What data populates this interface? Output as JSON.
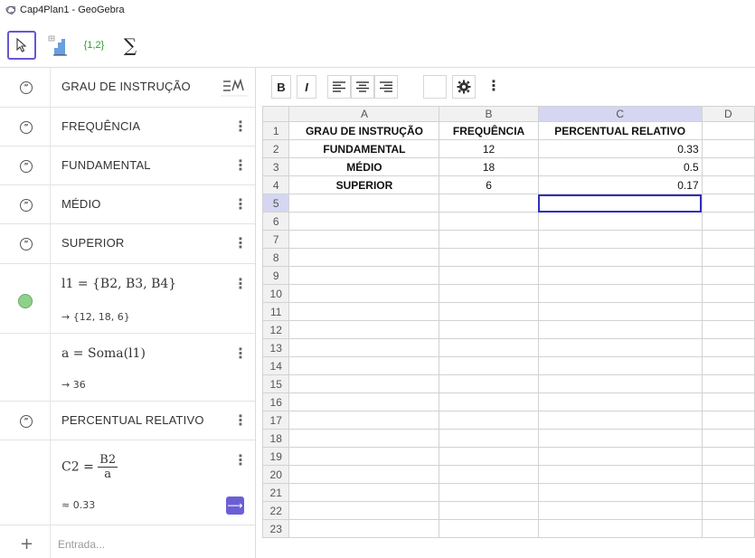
{
  "window": {
    "title": "Cap4Plan1 - GeoGebra"
  },
  "toolbar": {
    "tools": [
      {
        "name": "move-tool",
        "icon": "cursor-arrow-icon"
      },
      {
        "name": "bar-chart-tool",
        "icon": "bar-chart-icon"
      },
      {
        "name": "list-tool",
        "label": "{1,2}"
      },
      {
        "name": "sum-tool",
        "label": "∑"
      }
    ]
  },
  "algebra": {
    "items": [
      {
        "kind": "text",
        "text": "GRAU DE INSTRUÇÃO"
      },
      {
        "kind": "text",
        "text": "FREQUÊNCIA"
      },
      {
        "kind": "text",
        "text": "FUNDAMENTAL"
      },
      {
        "kind": "text",
        "text": "MÉDIO"
      },
      {
        "kind": "text",
        "text": "SUPERIOR"
      },
      {
        "kind": "list",
        "definition": "l1 = {B2, B3, B4}",
        "output": "→ {12, 18, 6}"
      },
      {
        "kind": "number",
        "definition": "a = Soma(l1)",
        "output": "→ 36"
      },
      {
        "kind": "text",
        "text": "PERCENTUAL RELATIVO"
      },
      {
        "kind": "fraction",
        "lhs": "C2 =",
        "num": "B2",
        "den": "a",
        "output": "≈ 0.33"
      }
    ],
    "input_placeholder": "Entrada..."
  },
  "stylebar": {
    "bold": "B",
    "italic": "I"
  },
  "sheet": {
    "columns": [
      "A",
      "B",
      "C",
      "D"
    ],
    "selected_column": "C",
    "rows": [
      {
        "n": "1",
        "cells": [
          "GRAU DE INSTRUÇÃO",
          "FREQUÊNCIA",
          "PERCENTUAL RELATIVO",
          ""
        ]
      },
      {
        "n": "2",
        "cells": [
          "FUNDAMENTAL",
          "12",
          "0.33",
          ""
        ]
      },
      {
        "n": "3",
        "cells": [
          "MÉDIO",
          "18",
          "0.5",
          ""
        ]
      },
      {
        "n": "4",
        "cells": [
          "SUPERIOR",
          "6",
          "0.17",
          ""
        ]
      },
      {
        "n": "5",
        "cells": [
          "",
          "",
          "",
          ""
        ]
      },
      {
        "n": "6",
        "cells": [
          "",
          "",
          "",
          ""
        ]
      },
      {
        "n": "7",
        "cells": [
          "",
          "",
          "",
          ""
        ]
      },
      {
        "n": "8",
        "cells": [
          "",
          "",
          "",
          ""
        ]
      },
      {
        "n": "9",
        "cells": [
          "",
          "",
          "",
          ""
        ]
      },
      {
        "n": "10",
        "cells": [
          "",
          "",
          "",
          ""
        ]
      },
      {
        "n": "11",
        "cells": [
          "",
          "",
          "",
          ""
        ]
      },
      {
        "n": "12",
        "cells": [
          "",
          "",
          "",
          ""
        ]
      },
      {
        "n": "13",
        "cells": [
          "",
          "",
          "",
          ""
        ]
      },
      {
        "n": "14",
        "cells": [
          "",
          "",
          "",
          ""
        ]
      },
      {
        "n": "15",
        "cells": [
          "",
          "",
          "",
          ""
        ]
      },
      {
        "n": "16",
        "cells": [
          "",
          "",
          "",
          ""
        ]
      },
      {
        "n": "17",
        "cells": [
          "",
          "",
          "",
          ""
        ]
      },
      {
        "n": "18",
        "cells": [
          "",
          "",
          "",
          ""
        ]
      },
      {
        "n": "19",
        "cells": [
          "",
          "",
          "",
          ""
        ]
      },
      {
        "n": "20",
        "cells": [
          "",
          "",
          "",
          ""
        ]
      },
      {
        "n": "21",
        "cells": [
          "",
          "",
          "",
          ""
        ]
      },
      {
        "n": "22",
        "cells": [
          "",
          "",
          "",
          ""
        ]
      },
      {
        "n": "23",
        "cells": [
          "",
          "",
          "",
          ""
        ]
      }
    ],
    "active_cell": "C5"
  },
  "colors": {
    "accent": "#6557d2",
    "selection": "#d5d6f2",
    "active_border": "#2f2fbf",
    "point_green": "#8fd18a"
  }
}
